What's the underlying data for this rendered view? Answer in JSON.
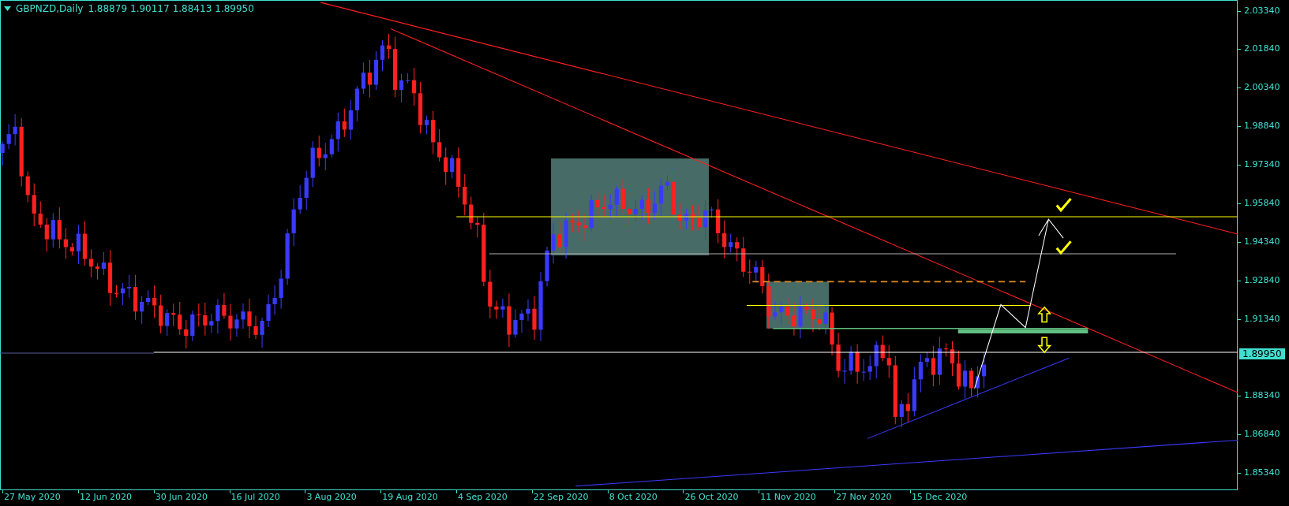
{
  "header": {
    "symbol_timeframe": "GBPNZD,Daily",
    "ohlc": [
      "1.88879",
      "1.90117",
      "1.88413",
      "1.89950"
    ]
  },
  "price_axis": {
    "ticks": [
      "2.03340",
      "2.01840",
      "2.00340",
      "1.98840",
      "1.97340",
      "1.95840",
      "1.94340",
      "1.92840",
      "1.91340",
      "1.88340",
      "1.86840",
      "1.85340"
    ],
    "current_price": "1.89950"
  },
  "date_axis": {
    "labels": [
      "27 May 2020",
      "12 Jun 2020",
      "30 Jun 2020",
      "16 Jul 2020",
      "3 Aug 2020",
      "19 Aug 2020",
      "4 Sep 2020",
      "22 Sep 2020",
      "8 Oct 2020",
      "26 Oct 2020",
      "11 Nov 2020",
      "27 Nov 2020",
      "15 Dec 2020"
    ]
  }
}
